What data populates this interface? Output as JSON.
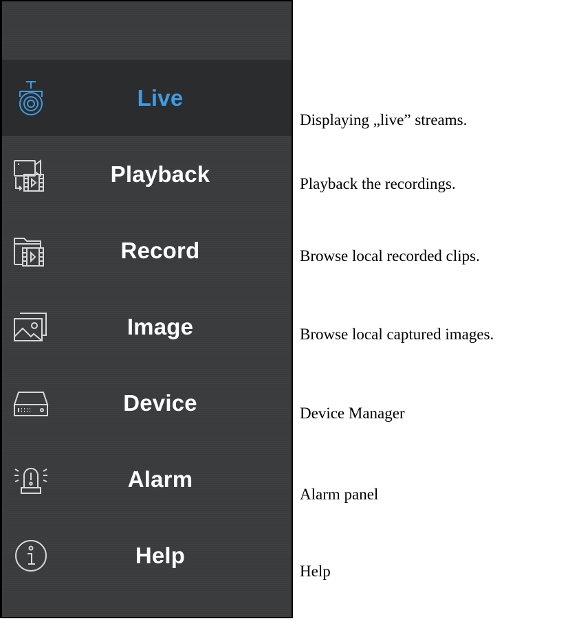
{
  "menu": {
    "items": [
      {
        "label": "Live",
        "icon": "camera-icon",
        "active": true,
        "description": "Displaying „live” streams."
      },
      {
        "label": "Playback",
        "icon": "playback-icon",
        "active": false,
        "description": "Playback the recordings."
      },
      {
        "label": "Record",
        "icon": "record-folder-icon",
        "active": false,
        "description": "Browse local recorded clips."
      },
      {
        "label": "Image",
        "icon": "image-icon",
        "active": false,
        "description": "Browse local captured images."
      },
      {
        "label": "Device",
        "icon": "device-icon",
        "active": false,
        "description": "Device Manager"
      },
      {
        "label": "Alarm",
        "icon": "alarm-icon",
        "active": false,
        "description": "Alarm panel"
      },
      {
        "label": "Help",
        "icon": "info-icon",
        "active": false,
        "description": "Help"
      }
    ]
  },
  "colors": {
    "panel_background": "#3a3b3d",
    "active_background": "#2b2c2e",
    "active_accent": "#3f9be3",
    "label": "#ffffff",
    "icon_stroke": "#d8d8d8"
  }
}
